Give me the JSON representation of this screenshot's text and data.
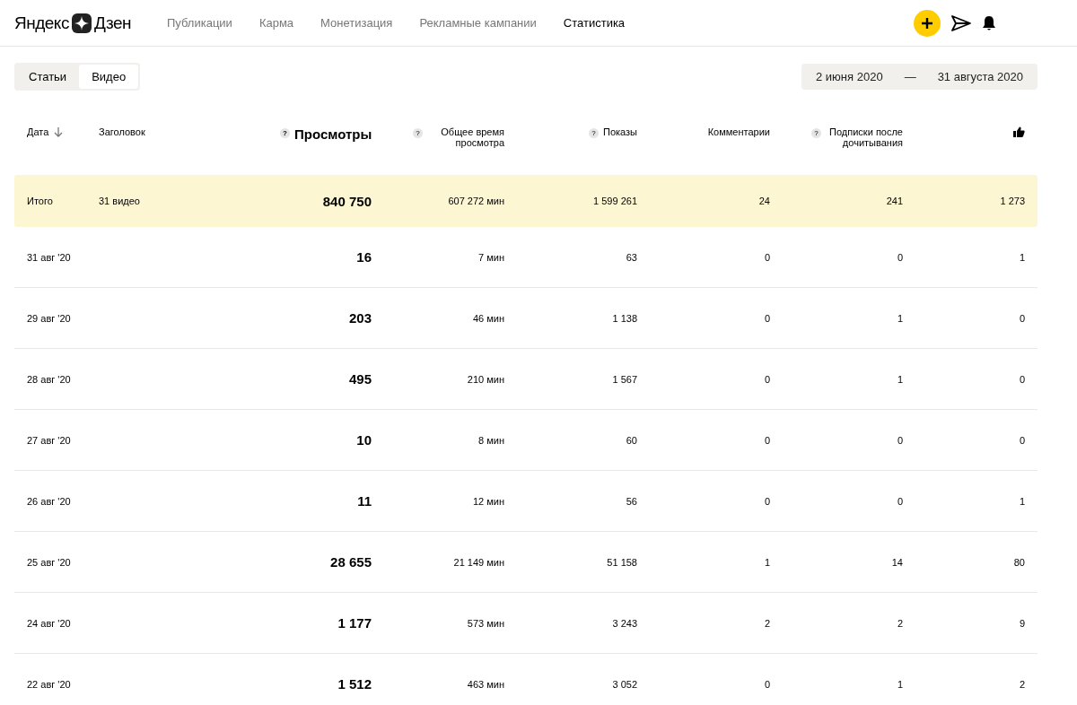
{
  "header": {
    "logo_left": "Яндекс",
    "logo_right": "Дзен",
    "nav": [
      {
        "label": "Публикации",
        "selected": false
      },
      {
        "label": "Карма",
        "selected": false
      },
      {
        "label": "Монетизация",
        "selected": false
      },
      {
        "label": "Рекламные кампании",
        "selected": false
      },
      {
        "label": "Статистика",
        "selected": true
      }
    ]
  },
  "content_tabs": [
    {
      "label": "Статьи",
      "selected": false
    },
    {
      "label": "Видео",
      "selected": true
    }
  ],
  "date_range": {
    "from": "2 июня 2020",
    "separator": "—",
    "to": "31 августа 2020"
  },
  "table": {
    "columns": [
      {
        "kind": "text",
        "label": "Дата",
        "sorted": true
      },
      {
        "kind": "text",
        "label": "Заголовок",
        "sorted": false
      },
      {
        "kind": "main",
        "label": "Просмотры",
        "help": "?",
        "sorted": false
      },
      {
        "kind": "text",
        "label": "Общее время просмотра",
        "help": "?",
        "sorted": false
      },
      {
        "kind": "text",
        "label": "Показы",
        "help": "?",
        "sorted": false
      },
      {
        "kind": "text",
        "label": "Комментарии",
        "sorted": false
      },
      {
        "kind": "text",
        "label": "Подписки после дочитывания",
        "help": "?",
        "sorted": false
      },
      {
        "kind": "icon",
        "sorted": false
      }
    ],
    "total": [
      "Итого",
      "31 видео",
      "840 750",
      "607 272 мин",
      "1 599 261",
      "24",
      "241",
      "1 273"
    ],
    "rows": [
      [
        "31 авг '20",
        "",
        "16",
        "7 мин",
        "63",
        "0",
        "0",
        "1"
      ],
      [
        "29 авг '20",
        "",
        "203",
        "46 мин",
        "1 138",
        "0",
        "1",
        "0"
      ],
      [
        "28 авг '20",
        "",
        "495",
        "210 мин",
        "1 567",
        "0",
        "1",
        "0"
      ],
      [
        "27 авг '20",
        "",
        "10",
        "8 мин",
        "60",
        "0",
        "0",
        "0"
      ],
      [
        "26 авг '20",
        "",
        "11",
        "12 мин",
        "56",
        "0",
        "0",
        "1"
      ],
      [
        "25 авг '20",
        "",
        "28 655",
        "21 149 мин",
        "51 158",
        "1",
        "14",
        "80"
      ],
      [
        "24 авг '20",
        "",
        "1 177",
        "573 мин",
        "3 243",
        "2",
        "2",
        "9"
      ],
      [
        "22 авг '20",
        "",
        "1 512",
        "463 мин",
        "3 052",
        "0",
        "1",
        "2"
      ]
    ]
  }
}
